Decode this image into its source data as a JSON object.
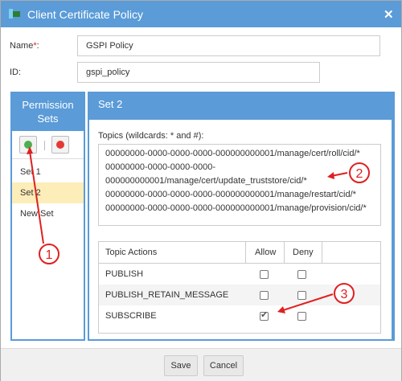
{
  "dialog": {
    "title": "Client Certificate Policy",
    "close_glyph": "✕"
  },
  "form": {
    "name_label": "Name",
    "required_mark": "*",
    "name_colon": ":",
    "name_value": "GSPI Policy",
    "id_label": "ID:",
    "id_value": "gspi_policy"
  },
  "permission_sets": {
    "title_line1": "Permission",
    "title_line2": "Sets",
    "items": [
      {
        "label": "Set 1",
        "selected": false
      },
      {
        "label": "Set 2",
        "selected": true
      },
      {
        "label": "New Set",
        "selected": false
      }
    ]
  },
  "set_detail": {
    "title": "Set 2",
    "topics_label": "Topics (wildcards: * and #):",
    "topics_lines": [
      "00000000-0000-0000-0000-000000000001/manage/cert/roll/cid/*",
      "00000000-0000-0000-0000-",
      "000000000001/manage/cert/update_truststore/cid/*",
      "00000000-0000-0000-0000-000000000001/manage/restart/cid/*",
      "00000000-0000-0000-0000-000000000001/manage/provision/cid/*"
    ],
    "table": {
      "headers": {
        "actions": "Topic Actions",
        "allow": "Allow",
        "deny": "Deny"
      },
      "rows": [
        {
          "action": "PUBLISH",
          "allow": false,
          "deny": false
        },
        {
          "action": "PUBLISH_RETAIN_MESSAGE",
          "allow": false,
          "deny": false
        },
        {
          "action": "SUBSCRIBE",
          "allow": true,
          "deny": false
        }
      ]
    }
  },
  "footer": {
    "save_label": "Save",
    "cancel_label": "Cancel"
  },
  "callouts": [
    "1",
    "2",
    "3"
  ],
  "colors": {
    "header_blue": "#5a9bd8",
    "selected_row": "#fdedb8",
    "callout_red": "#e02020",
    "add_green": "#4caf50",
    "remove_red": "#e53935"
  }
}
